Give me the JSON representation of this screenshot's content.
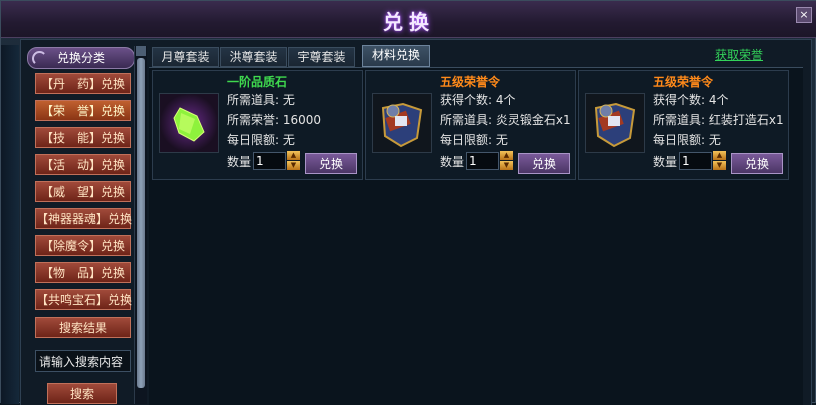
{
  "window": {
    "title": "兑换",
    "close_label": "×"
  },
  "sidebar": {
    "header": "兑换分类",
    "items": [
      {
        "label": "【丹　药】兑换",
        "active": false
      },
      {
        "label": "【荣　誉】兑换",
        "active": true
      },
      {
        "label": "【技　能】兑换",
        "active": false
      },
      {
        "label": "【活　动】兑换",
        "active": false
      },
      {
        "label": "【威　望】兑换",
        "active": false
      },
      {
        "label": "【神器器魂】兑换",
        "active": false
      },
      {
        "label": "【除魔令】兑换",
        "active": false
      },
      {
        "label": "【物　品】兑换",
        "active": false
      },
      {
        "label": "【共鸣宝石】兑换",
        "active": false
      },
      {
        "label": "搜索结果",
        "active": false
      }
    ],
    "search_placeholder": "请输入搜索内容",
    "search_value": "请输入搜索内容",
    "search_button": "搜索"
  },
  "tabs": [
    {
      "label": "月尊套装",
      "active": false
    },
    {
      "label": "洪尊套装",
      "active": false
    },
    {
      "label": "宇尊套装",
      "active": false
    },
    {
      "label": "材料兑换",
      "active": true
    }
  ],
  "link": "获取荣誉",
  "qty_label": "数量",
  "exchange_label": "兑换",
  "items": [
    {
      "name": "一阶品质石",
      "name_color": "#3fd94e",
      "icon": "green-crystal-icon",
      "lines": [
        "所需道具: 无",
        "所需荣誉: 16000",
        "每日限额: 无"
      ],
      "qty": "1"
    },
    {
      "name": "五级荣誉令",
      "name_color": "#ff8a1a",
      "icon": "honor-token-icon",
      "lines": [
        "获得个数: 4个",
        "所需道具: 炎灵锻金石x1",
        "每日限额: 无"
      ],
      "qty": "1"
    },
    {
      "name": "五级荣誉令",
      "name_color": "#ff8a1a",
      "icon": "honor-token-icon",
      "lines": [
        "获得个数: 4个",
        "所需道具: 红装打造石x1",
        "每日限额: 无"
      ],
      "qty": "1"
    }
  ],
  "colors": {
    "active_tab": "#3e5266",
    "link": "#33d35a",
    "button": "#7a5a9a"
  }
}
